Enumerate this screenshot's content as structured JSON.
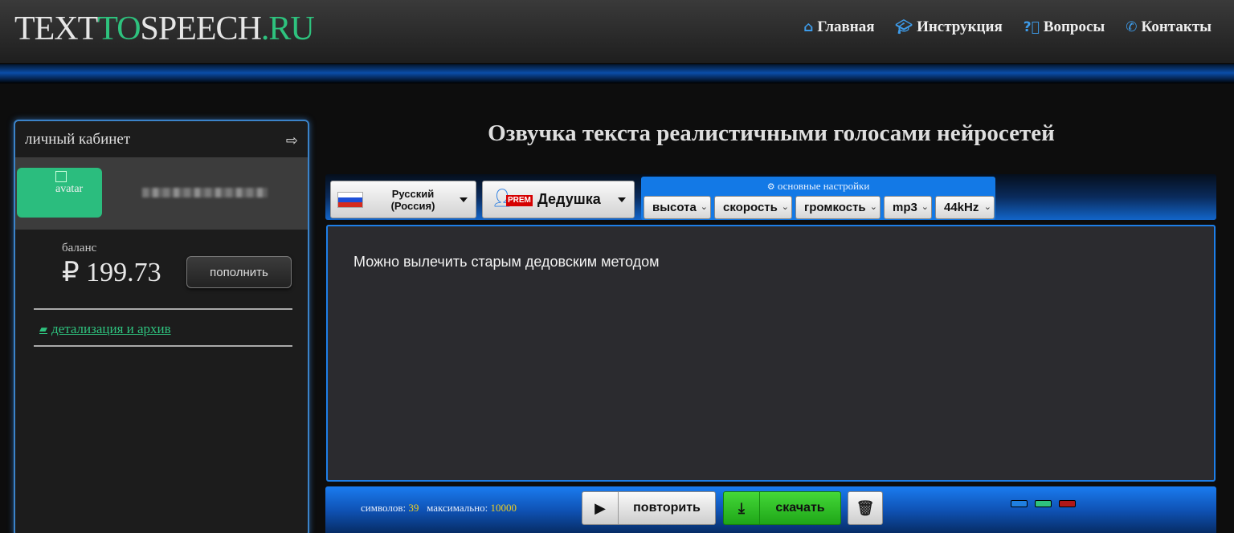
{
  "header": {
    "logo_part1": "TEXT",
    "logo_part2": "TO",
    "logo_part3": "SPEECH",
    "logo_part4": ".RU",
    "nav": [
      {
        "label": "Главная",
        "icon": "home-icon"
      },
      {
        "label": "Инструкция",
        "icon": "graduation-cap-icon"
      },
      {
        "label": "Вопросы",
        "icon": "question-circle-icon"
      },
      {
        "label": "Контакты",
        "icon": "phone-icon"
      }
    ]
  },
  "sidebar": {
    "title": "личный кабинет",
    "avatar_alt": "avatar",
    "balance_label": "баланс",
    "balance_value": "₽ 199.73",
    "refill_label": "пополнить",
    "archive_link": "детализация и архив"
  },
  "main": {
    "title": "Озвучка текста реалистичными голосами нейросетей",
    "language": {
      "line1": "Русский",
      "line2": "(Россия)"
    },
    "voice": {
      "badge": "PREM",
      "name": "Дедушка"
    },
    "settings": {
      "title": "основные настройки",
      "options": [
        "высота",
        "скорость",
        "громкость",
        "mp3",
        "44kHz"
      ]
    },
    "editor_text": "Можно вылечить старым дедовским методом",
    "counter": {
      "chars_label": "символов:",
      "chars_value": "39",
      "max_label": "максимально:",
      "max_value": "10000"
    },
    "repeat_label": "повторить",
    "download_label": "скачать",
    "swatch_colors": [
      "#1f7fe0",
      "#2ec27e",
      "#b01818"
    ]
  },
  "colors": {
    "accent_green": "#2ec27e",
    "accent_blue": "#1379e6",
    "counter_yellow": "#f0d020"
  }
}
